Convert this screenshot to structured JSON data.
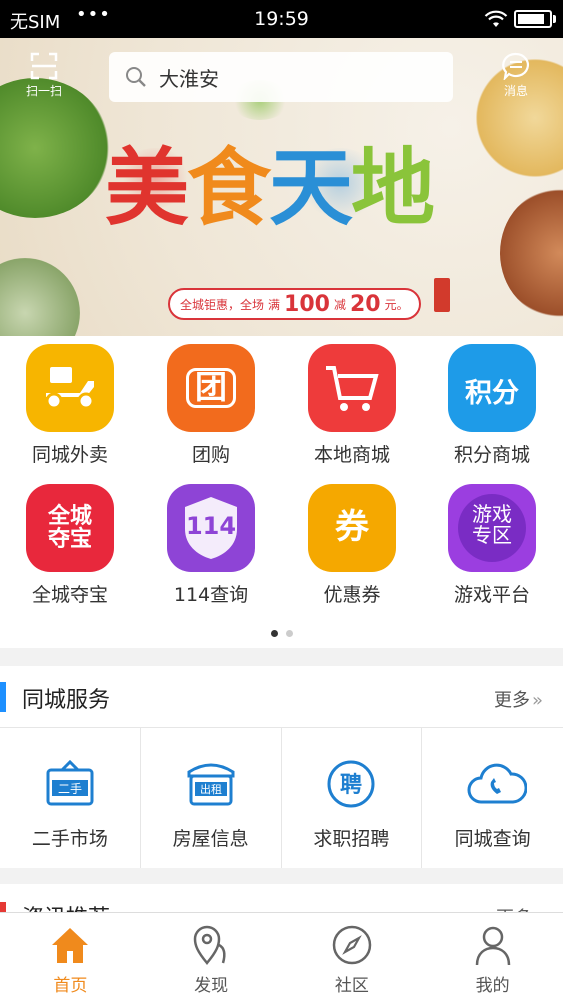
{
  "status_bar": {
    "carrier": "无SIM",
    "signal_dots": "•••",
    "time": "19:59"
  },
  "header": {
    "scan_label": "扫一扫",
    "search_text": "大淮安",
    "message_label": "消息"
  },
  "banner": {
    "title_chars": [
      "美",
      "食",
      "天",
      "地"
    ],
    "promo_prefix": "全城钜惠，全场",
    "promo_man": "满",
    "promo_amount": "100",
    "promo_jian": "减",
    "promo_discount": "20",
    "promo_suffix": "元。",
    "pages": 3,
    "current_page": 1
  },
  "menu": {
    "items": [
      {
        "label": "同城外卖",
        "icon": "scooter-icon",
        "color": "#f7b500",
        "glyph": ""
      },
      {
        "label": "团购",
        "icon": "group-buy-icon",
        "color": "#f26b1d",
        "glyph": "团"
      },
      {
        "label": "本地商城",
        "icon": "cart-icon",
        "color": "#ee3b3b",
        "glyph": ""
      },
      {
        "label": "积分商城",
        "icon": "points-bag-icon",
        "color": "#1e9be8",
        "glyph": "积分"
      },
      {
        "label": "全城夺宝",
        "icon": "treasure-icon",
        "color": "#e8283c",
        "glyph": "全城\n夺宝"
      },
      {
        "label": "114查询",
        "icon": "shield-114-icon",
        "color": "#8e44d6",
        "glyph": "114"
      },
      {
        "label": "优惠券",
        "icon": "coupon-icon",
        "color": "#f5a800",
        "glyph": "券"
      },
      {
        "label": "游戏平台",
        "icon": "game-zone-icon",
        "color": "#9b3ee0",
        "glyph": "游戏\n专区"
      }
    ],
    "pages": 2,
    "current_page": 1
  },
  "services": {
    "title": "同城服务",
    "more": "更多",
    "items": [
      {
        "label": "二手市场",
        "icon": "second-hand-sign-icon",
        "glyph": "二手"
      },
      {
        "label": "房屋信息",
        "icon": "house-rent-icon",
        "glyph": "出租"
      },
      {
        "label": "求职招聘",
        "icon": "recruit-icon",
        "glyph": "聘"
      },
      {
        "label": "同城查询",
        "icon": "phone-cloud-icon",
        "glyph": ""
      }
    ]
  },
  "news": {
    "title": "资讯推荐",
    "more": "更多"
  },
  "tab_bar": {
    "tabs": [
      {
        "label": "首页",
        "icon": "home-icon",
        "active": true
      },
      {
        "label": "发现",
        "icon": "map-pin-icon",
        "active": false
      },
      {
        "label": "社区",
        "icon": "compass-icon",
        "active": false
      },
      {
        "label": "我的",
        "icon": "person-icon",
        "active": false
      }
    ]
  },
  "colors": {
    "accent_orange": "#f08a1c",
    "service_blue": "#1e90ff",
    "news_red": "#e53935"
  }
}
